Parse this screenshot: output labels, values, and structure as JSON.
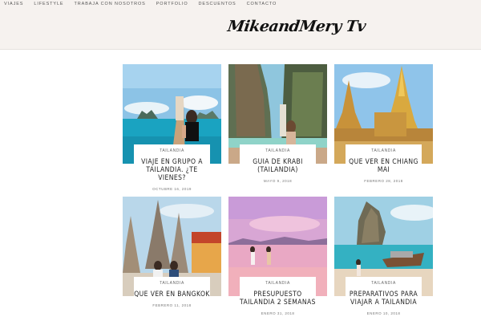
{
  "nav": {
    "items": [
      {
        "label": "VIAJES"
      },
      {
        "label": "LIFESTYLE"
      },
      {
        "label": "TRABAJA CON NOSOTROS"
      },
      {
        "label": "PORTFOLIO"
      },
      {
        "label": "DESCUENTOS"
      },
      {
        "label": "CONTACTO"
      }
    ]
  },
  "logo": {
    "text": "MikeandMery Tv"
  },
  "posts": [
    {
      "category": "TAILANDIA",
      "title": "VIAJE EN GRUPO A TAILANDIA. ¿TE VIENES?",
      "date": "OCTUBRE 16, 2019"
    },
    {
      "category": "TAILANDIA",
      "title": "GUIA DE KRABI (TAILANDIA)",
      "date": "MAYO 9, 2018"
    },
    {
      "category": "TAILANDIA",
      "title": "QUE VER EN CHIANG MAI",
      "date": "FEBRERO 28, 2018"
    },
    {
      "category": "TAILANDIA",
      "title": "QUE VER EN BANGKOK",
      "date": "FEBRERO 11, 2018"
    },
    {
      "category": "TAILANDIA",
      "title": "PRESUPUESTO TAILANDIA 2 SEMANAS",
      "date": "ENERO 31, 2018"
    },
    {
      "category": "TAILANDIA",
      "title": "PREPARATIVOS PARA VIAJAR A TAILANDIA",
      "date": "ENERO 10, 2018"
    }
  ]
}
